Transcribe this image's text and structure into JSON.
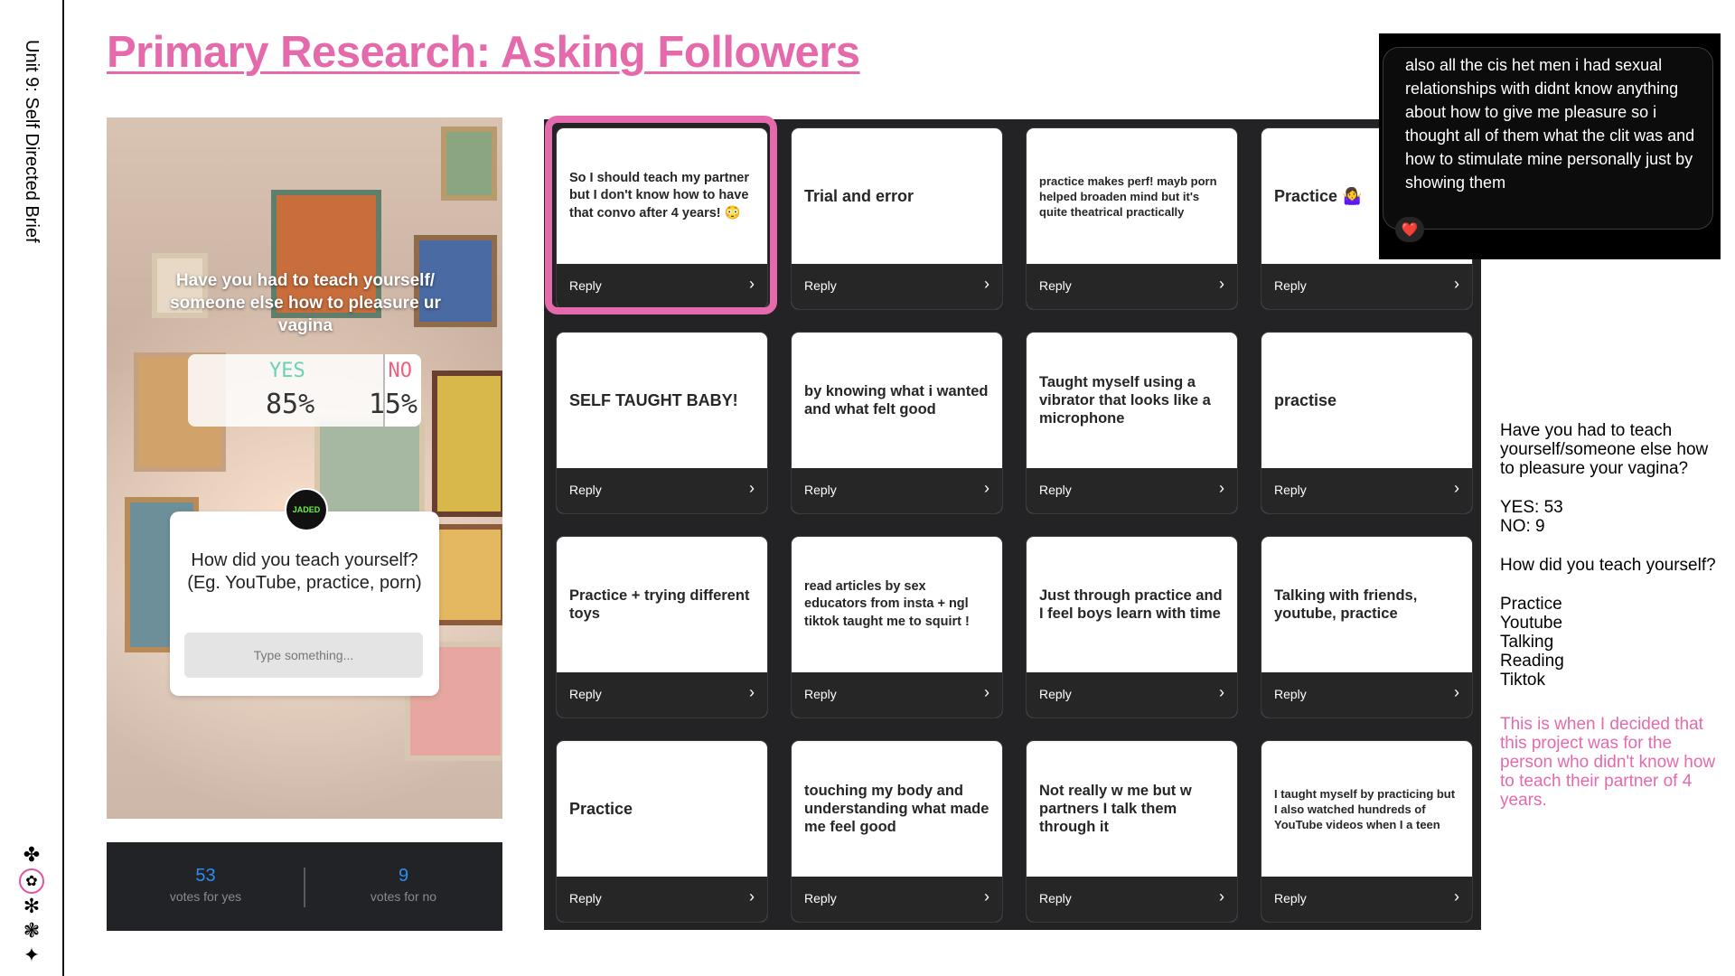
{
  "sidebar": {
    "title": "Unit 9: Self Directed Brief",
    "icons": [
      "✤",
      "✿",
      "✻",
      "❃",
      "✦"
    ]
  },
  "page_title": "Primary Research: Asking Followers",
  "story": {
    "question": "Have you had to teach yourself/ someone else how to pleasure ur vagina",
    "poll": {
      "yes_label": "YES",
      "no_label": "NO",
      "yes_pct": "85%",
      "no_pct": "15%",
      "yes_fraction": 0.85
    },
    "avatar_text": "JADED",
    "question_box": "How did you teach yourself? (Eg. YouTube, practice, porn)",
    "input_placeholder": "Type something..."
  },
  "votes": {
    "yes_count": "53",
    "yes_label": "votes for yes",
    "no_count": "9",
    "no_label": "votes for no"
  },
  "responses": {
    "reply_label": "Reply",
    "cards": [
      {
        "text": "So I should teach my partner but I don't know how to have that convo after 4 years! 😳"
      },
      {
        "text": "Trial and error"
      },
      {
        "text": "practice makes perf! mayb porn helped broaden mind but it's quite theatrical practically"
      },
      {
        "text": "Practice 🤷‍♀️"
      },
      {
        "text": "SELF TAUGHT BABY!"
      },
      {
        "text": "by knowing what i wanted and what felt good"
      },
      {
        "text": "Taught myself using a vibrator that looks like a microphone"
      },
      {
        "text": "practise"
      },
      {
        "text": "Practice + trying different toys"
      },
      {
        "text": "read articles by sex educators from insta + ngl tiktok taught me to squirt !"
      },
      {
        "text": "Just through practice and I feel boys learn with time"
      },
      {
        "text": "Talking with friends, youtube, practice"
      },
      {
        "text": "Practice"
      },
      {
        "text": "touching my body and understanding what made me feel good"
      },
      {
        "text": "Not really w me but w partners I talk them through it"
      },
      {
        "text": "I taught myself by practicing but I also watched hundreds of YouTube videos when I a teen"
      }
    ]
  },
  "dm": {
    "text": "also all the cis het men i had sexual relationships with didnt know anything about how to give me pleasure so i thought all of them what the clit was and how to stimulate mine personally just by showing them",
    "reaction": "❤️"
  },
  "notes": {
    "question": "Have you had to teach yourself/someone else how to pleasure your vagina?",
    "yes": "YES: 53",
    "no": "NO: 9",
    "how": "How did you teach yourself?",
    "methods": [
      "Practice",
      "Youtube",
      "Talking",
      "Reading",
      "Tiktok"
    ],
    "conclusion": "This is when I decided that this project was for the person who didn't know how to teach their partner of 4 years."
  },
  "colors": {
    "accent_pink": "#e46aab",
    "vote_blue": "#2d8cf0",
    "grid_bg": "#232326"
  }
}
